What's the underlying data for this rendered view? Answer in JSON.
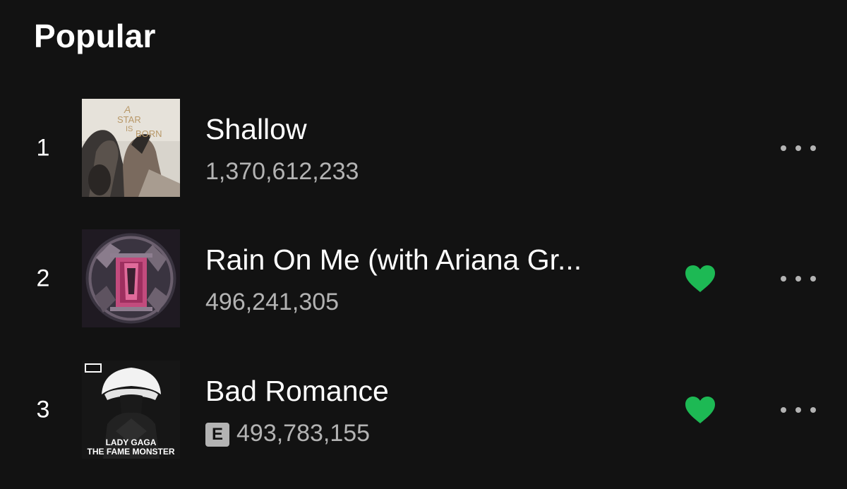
{
  "section": {
    "title": "Popular"
  },
  "colors": {
    "background": "#121212",
    "accent_green": "#1db954",
    "secondary_text": "#b3b3b3"
  },
  "tracks": [
    {
      "number": "1",
      "title": "Shallow",
      "plays": "1,370,612,233",
      "liked": false,
      "explicit": false,
      "cover_icon": "album-cover-a-star-is-born"
    },
    {
      "number": "2",
      "title": "Rain On Me (with Ariana Gr...",
      "plays": "496,241,305",
      "liked": true,
      "explicit": false,
      "cover_icon": "album-cover-chromatica"
    },
    {
      "number": "3",
      "title": "Bad Romance",
      "plays": "493,783,155",
      "liked": true,
      "explicit": true,
      "explicit_label": "E",
      "cover_icon": "album-cover-the-fame-monster",
      "cover_text": {
        "artist": "LADY GAGA",
        "album": "THE FAME MONSTER"
      }
    }
  ],
  "icons": {
    "like": "heart-icon",
    "more": "more-options-icon"
  }
}
